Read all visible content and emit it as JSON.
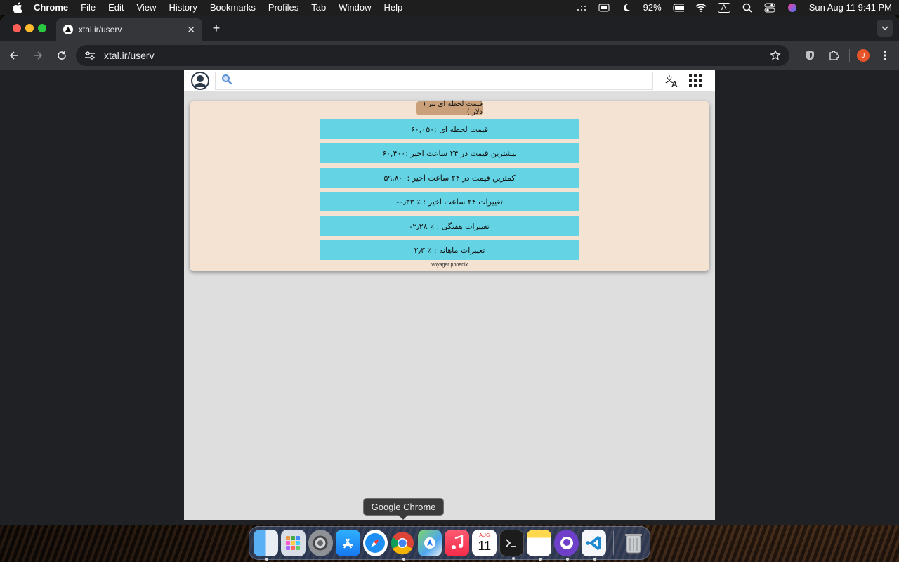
{
  "menubar": {
    "app_name": "Chrome",
    "menus": [
      "File",
      "Edit",
      "View",
      "History",
      "Bookmarks",
      "Profiles",
      "Tab",
      "Window",
      "Help"
    ],
    "battery": "92%",
    "input_source": "A",
    "datetime": "Sun Aug 11  9:41 PM"
  },
  "browser": {
    "tab_title": "xtal.ir/userv",
    "url": "xtal.ir/userv",
    "profile_initial": "J"
  },
  "site": {
    "search_placeholder": "",
    "panel_title": "قیمت لحظه ای تتر ( دلار )",
    "stats": [
      "قیمت لحظه ای :۶۰,۰۵۰",
      "بیشترین قیمت در ۲۴ ساعت اخیر :۶۰,۴۰۰",
      "کمترین قیمت در ۲۴ ساعت اخیر :۵۹,۸۰۰",
      "تغییرات ۲۴ ساعت اخیر : ٪ ۰٫۳۳-",
      "تغییرات هفتگی : ٪ ۲٫۲۸-",
      "تغییرات ماهانه : ٪ ۲٫۳"
    ],
    "footer": "Voyager phoenix"
  },
  "dock": {
    "tooltip": "Google Chrome",
    "calendar_month": "AUG",
    "calendar_day": "11"
  }
}
